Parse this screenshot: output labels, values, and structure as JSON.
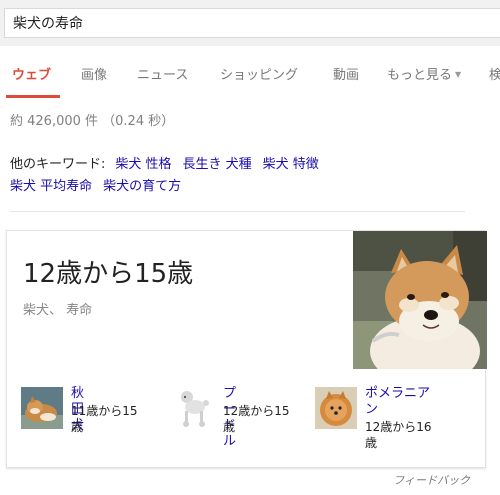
{
  "search": {
    "query": "柴犬の寿命"
  },
  "tabs": [
    {
      "label": "ウェブ"
    },
    {
      "label": "画像"
    },
    {
      "label": "ニュース"
    },
    {
      "label": "ショッピング"
    },
    {
      "label": "動画"
    },
    {
      "label": "もっと見る"
    },
    {
      "label": "検"
    }
  ],
  "results": {
    "stats": "約 426,000 件 （0.24 秒）",
    "related_label": "他のキーワード:",
    "related_links": [
      "柴犬 性格",
      "長生き 犬種",
      "柴犬 特徴",
      "柴犬 平均寿命",
      "柴犬の育て方"
    ]
  },
  "card": {
    "answer": "12歳から15歳",
    "subject": "柴犬、 寿命",
    "related": [
      {
        "name": "秋田犬",
        "value": "11歳から15歳"
      },
      {
        "name": "プードル",
        "value": "12歳から15歳"
      },
      {
        "name": "ポメラニアン",
        "value": "12歳から16歳"
      }
    ]
  },
  "feedback": "フィードバック",
  "colors": {
    "accent": "#dd4b39",
    "link": "#1a0dab"
  }
}
